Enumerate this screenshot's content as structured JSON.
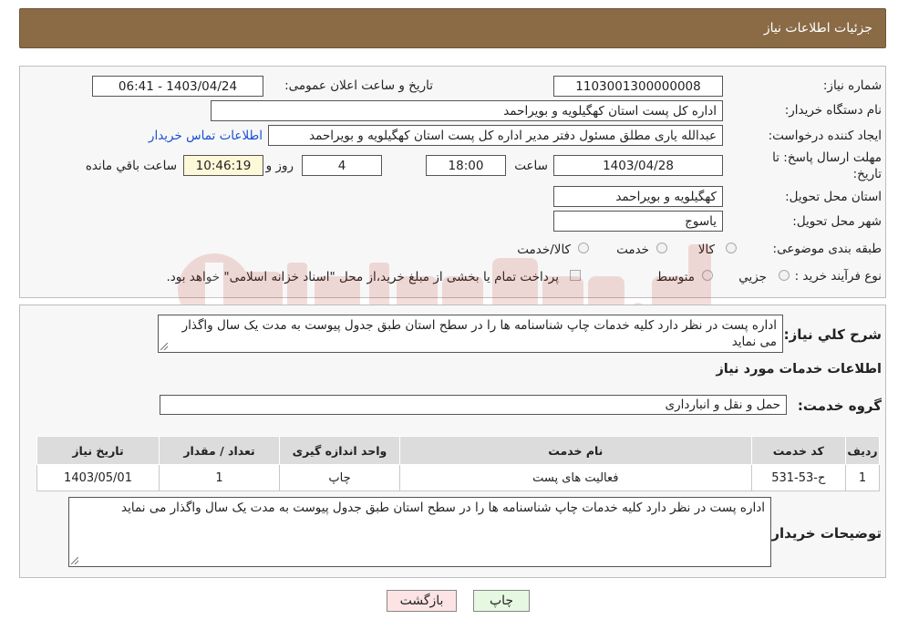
{
  "header": {
    "title": "جزئیات اطلاعات نیاز"
  },
  "form": {
    "need_number_label": "شماره نیاز:",
    "need_number": "1103001300000008",
    "announce_label": "تاریخ و ساعت اعلان عمومی:",
    "announce_value": "1403/04/24 - 06:41",
    "buyer_org_label": "نام دستگاه خریدار:",
    "buyer_org": "اداره کل پست استان کهگیلویه و بویراحمد",
    "creator_label": "ایجاد کننده درخواست:",
    "creator": "عبدالله یاری مطلق مسئول دفتر مدیر اداره کل پست استان کهگیلویه و بویراحمد",
    "contact_link": "اطلاعات تماس خریدار",
    "deadline_label": "مهلت ارسال پاسخ: تا تاریخ:",
    "deadline_date": "1403/04/28",
    "time_label": "ساعت",
    "deadline_time": "18:00",
    "days_value": "4",
    "days_label": "روز و",
    "remaining_time": "10:46:19",
    "remaining_label": "ساعت باقي مانده",
    "province_label": "استان محل تحویل:",
    "province": "کهگیلویه و بویراحمد",
    "city_label": "شهر محل تحویل:",
    "city": "یاسوج",
    "category_label": "طبقه بندی موضوعی:",
    "category_options": [
      "کالا",
      "خدمت",
      "کالا/خدمت"
    ],
    "process_label": "نوع فرآیند خرید :",
    "process_options": [
      "جزیي",
      "متوسط"
    ],
    "payment_note": "پرداخت تمام یا بخشی از مبلغ خرید،از محل \"اسناد خزانه اسلامی\" خواهد بود."
  },
  "details": {
    "summary_label": "شرح کلي نياز:",
    "summary": "اداره پست در نظر دارد کلیه خدمات چاپ شناسنامه  ها را در سطح استان  طبق جدول  پیوست  به مدت یک سال واگذار می نماید",
    "services_title": "اطلاعات خدمات مورد نياز",
    "service_group_label": "گروه خدمت:",
    "service_group": "حمل و نقل و انبارداری",
    "table": {
      "headers": [
        "رديف",
        "کد خدمت",
        "نام خدمت",
        "واحد اندازه گیری",
        "تعداد / مقدار",
        "تاریخ نیاز"
      ],
      "rows": [
        [
          "1",
          "ح-53-531",
          "فعالیت های پست",
          "چاپ",
          "1",
          "1403/05/01"
        ]
      ]
    },
    "buyer_notes_label": "توضیحات خریدار:",
    "buyer_notes": "اداره پست در نظر دارد کلیه خدمات چاپ شناسنامه  ها را در سطح استان  طبق جدول  پیوست  به مدت یک سال واگذار می نماید"
  },
  "buttons": {
    "print": "چاپ",
    "back": "بازگشت"
  },
  "colors": {
    "header_bg": "#8a6b45",
    "back_button_bg": "#fde4e4",
    "print_button_bg": "#e6f7e2",
    "link": "#1a4fd1"
  }
}
